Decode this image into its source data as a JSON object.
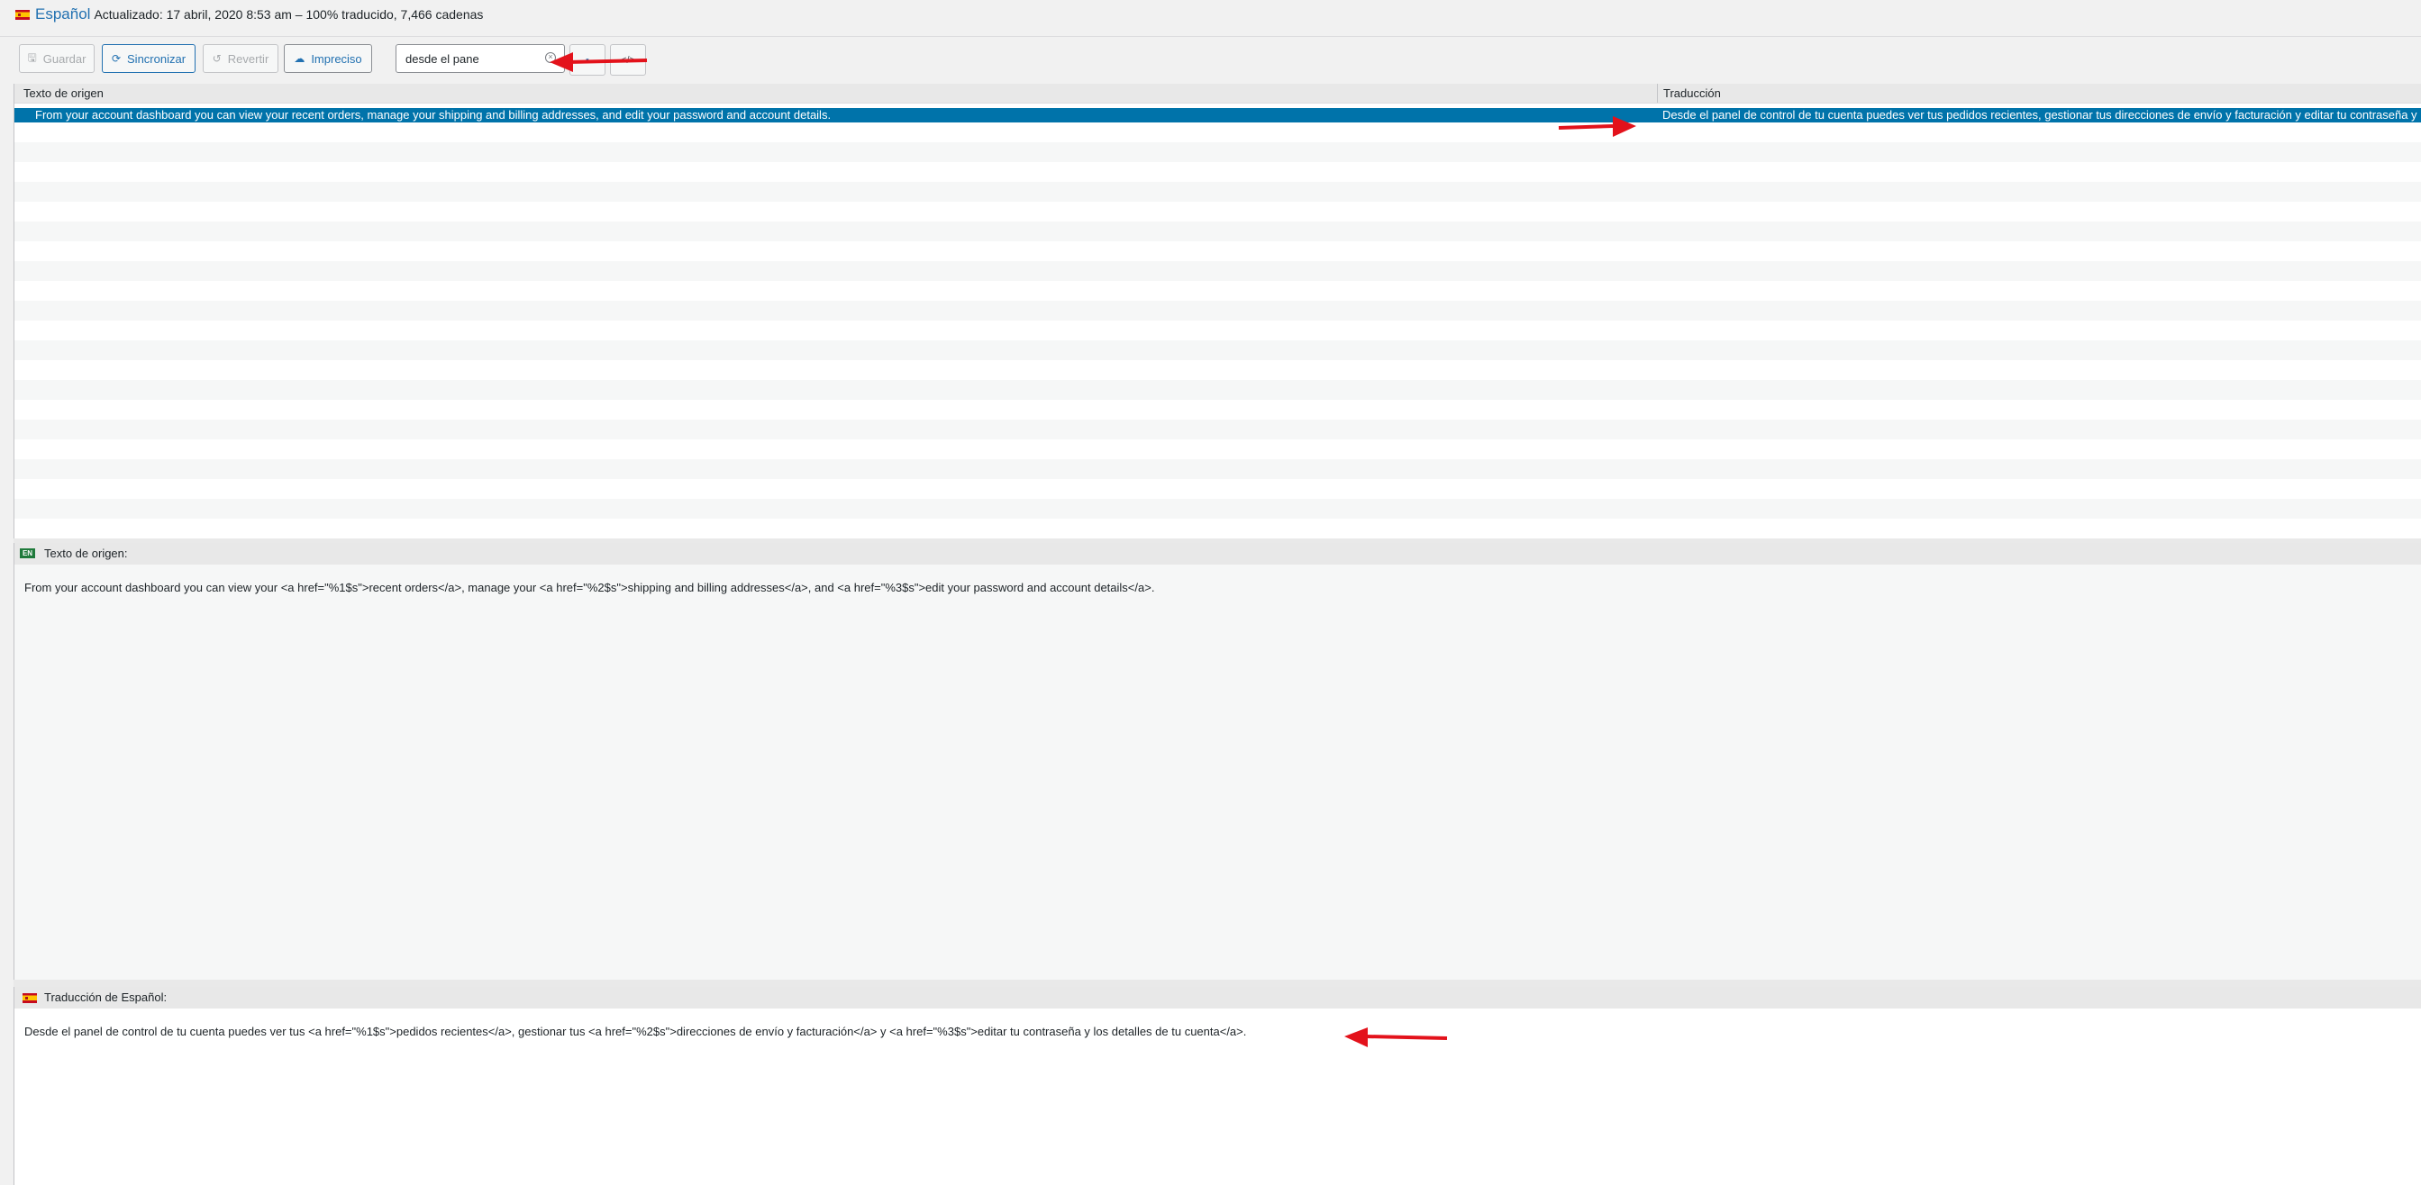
{
  "header": {
    "language": "Español",
    "meta": "Actualizado: 17 abril, 2020 8:53 am – 100% traducido, 7,466 cadenas"
  },
  "toolbar": {
    "save_label": "Guardar",
    "sync_label": "Sincronizar",
    "revert_label": "Revertir",
    "fuzzy_label": "Impreciso",
    "search_value": "desde el pane",
    "code_button_label": "</>"
  },
  "grid": {
    "columns": [
      "Texto de origen",
      "Traducción"
    ],
    "rows": [
      {
        "source": "From your account dashboard you can view your recent orders, manage your shipping and billing addresses, and edit your password and account details.",
        "translation": "Desde el panel de control de tu cuenta puedes ver tus pedidos recientes, gestionar tus direcciones de envío y facturación y editar tu contraseña y los detalles de tu cuenta.",
        "selected": true
      }
    ]
  },
  "source_panel": {
    "tag": "EN",
    "label": "Texto de origen:",
    "text": "From your account dashboard you can view your <a href=\"%1$s\">recent orders</a>, manage your <a href=\"%2$s\">shipping and billing addresses</a>, and <a href=\"%3$s\">edit your password and account details</a>."
  },
  "target_panel": {
    "label": "Traducción de Español:",
    "text": "Desde el panel de control de tu cuenta puedes ver tus <a href=\"%1$s\">pedidos recientes</a>, gestionar tus <a href=\"%2$s\">direcciones de envío y facturación</a> y <a href=\"%3$s\">editar tu contraseña y los detalles de tu cuenta</a>."
  },
  "colors": {
    "accent": "#2271b1",
    "selected_row": "#0073aa",
    "annotation_arrow": "#e3121b"
  },
  "icons": [
    "spain-flag-icon",
    "save-icon",
    "sync-icon",
    "revert-icon",
    "cloud-icon",
    "clear-search-icon",
    "en-language-tag"
  ]
}
